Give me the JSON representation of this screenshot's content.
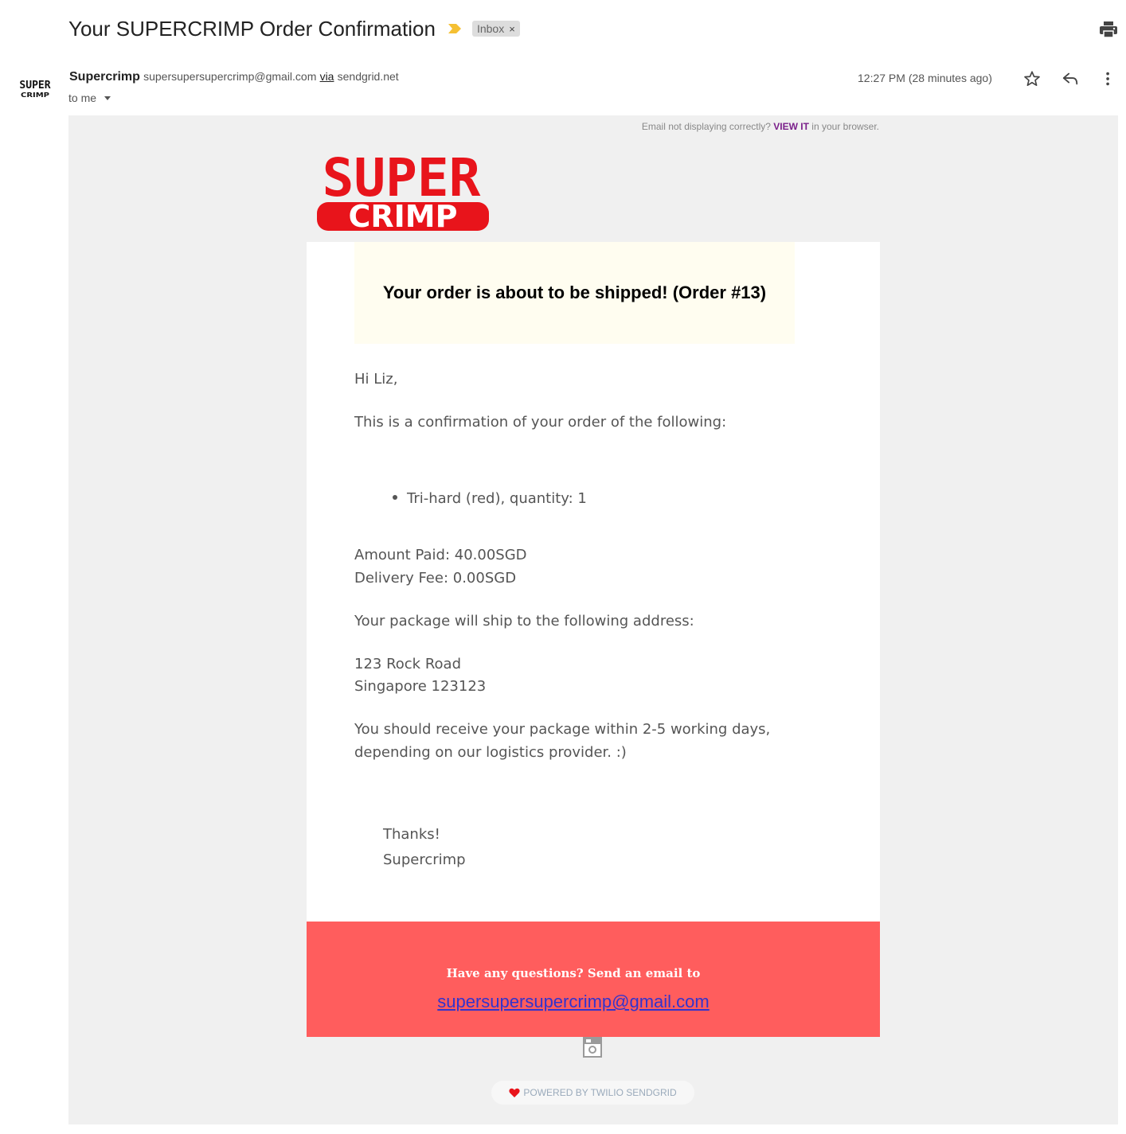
{
  "subject": "Your SUPERCRIMP Order Confirmation",
  "label": "Inbox",
  "label_close": "×",
  "sender": {
    "name": "Supercrimp",
    "email": "supersupersupercrimp@gmail.com",
    "via": "via",
    "via_domain": "sendgrid.net",
    "to": "to me"
  },
  "timestamp": "12:27 PM (28 minutes ago)",
  "avatar_text": {
    "top": "SUPER",
    "bottom": "CRIMP"
  },
  "email": {
    "browser_note": {
      "prefix": "Email not displaying correctly?",
      "link": "VIEW IT",
      "suffix": "in your browser."
    },
    "logo": {
      "top": "SUPER",
      "bottom": "CRIMP"
    },
    "banner_title": "Your order is about to be shipped! (Order #13)",
    "greeting": "Hi Liz,",
    "intro": "This is a confirmation of your order of the following:",
    "items": [
      "Tri-hard (red), quantity: 1"
    ],
    "amount_paid": "Amount Paid: 40.00SGD",
    "delivery_fee": "Delivery Fee: 0.00SGD",
    "ship_intro": "Your package will ship to the following address:",
    "address_line1": "123 Rock Road",
    "address_line2": "Singapore 123123",
    "eta_line1": "You should receive your package within 2-5 working days,",
    "eta_line2": "depending on our logistics provider. :)",
    "thanks": "Thanks!",
    "signoff": "Supercrimp",
    "footer_question": "Have any questions? Send an email to",
    "footer_email": "supersupersupercrimp@gmail.com",
    "powered_by": "POWERED BY TWILIO SENDGRID"
  },
  "colors": {
    "brand_red": "#e8141b",
    "footer_bg": "#ff5d5d",
    "banner_bg": "#fffdf0",
    "email_bg": "#f0f0f0",
    "important_marker": "#f5c033"
  },
  "icons": [
    "important-marker-icon",
    "print-icon",
    "star-icon",
    "reply-icon",
    "more-vert-icon",
    "instagram-icon",
    "heart-icon"
  ]
}
